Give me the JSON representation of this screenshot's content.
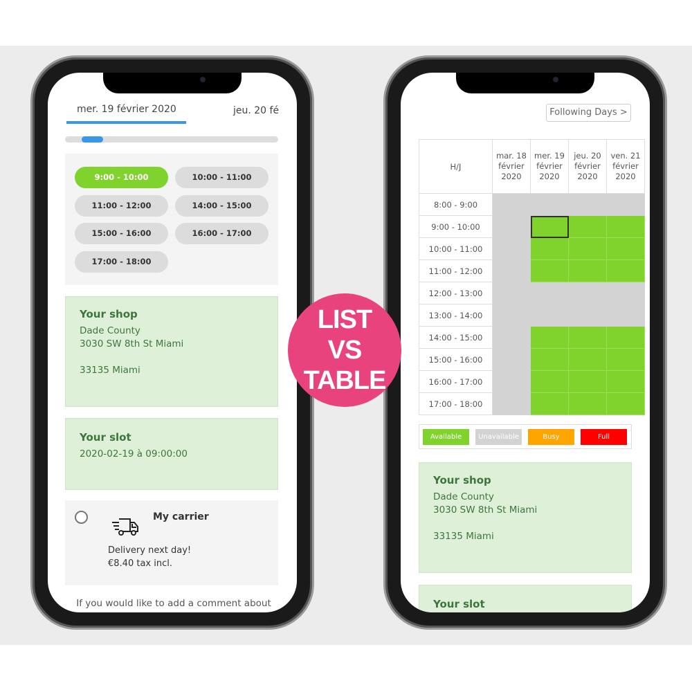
{
  "badge": {
    "line1": "LIST",
    "line2": "VS",
    "line3": "TABLE",
    "color": "#e8437c"
  },
  "list_view": {
    "tabs": [
      {
        "label": "mer. 19 février 2020",
        "active": true
      },
      {
        "label": "jeu. 20 fé",
        "active": false
      }
    ],
    "accent": "#3a97e8",
    "slots": [
      {
        "label": "9:00 - 10:00",
        "selected": true
      },
      {
        "label": "10:00 - 11:00"
      },
      {
        "label": "11:00 - 12:00"
      },
      {
        "label": "14:00 - 15:00"
      },
      {
        "label": "15:00 - 16:00"
      },
      {
        "label": "16:00 - 17:00"
      },
      {
        "label": "17:00 - 18:00"
      }
    ],
    "shop": {
      "title": "Your shop",
      "line1": "Dade County",
      "line2": "3030 SW 8th St Miami",
      "line3": "33135 Miami"
    },
    "slot_box": {
      "title": "Your slot",
      "value": "2020-02-19 à 09:00:00"
    },
    "carrier": {
      "name": "My carrier",
      "icon": "delivery-truck-icon",
      "desc": "Delivery next day!",
      "price": "€8.40 tax incl."
    },
    "comment": "If you would like to add a comment about your order, please write it in the field below."
  },
  "table_view": {
    "following_btn": "Following Days >",
    "corner": "H/J",
    "days": [
      "mar. 18 février 2020",
      "mer. 19 février 2020",
      "jeu. 20 février 2020",
      "ven. 21 février 2020"
    ],
    "hours": [
      "8:00 - 9:00",
      "9:00 - 10:00",
      "10:00 - 11:00",
      "11:00 - 12:00",
      "12:00 - 13:00",
      "13:00 - 14:00",
      "14:00 - 15:00",
      "15:00 - 16:00",
      "16:00 - 17:00",
      "17:00 - 18:00"
    ],
    "status": [
      [
        "u",
        "u",
        "u",
        "u"
      ],
      [
        "u",
        "a",
        "a",
        "a"
      ],
      [
        "u",
        "a",
        "a",
        "a"
      ],
      [
        "u",
        "a",
        "a",
        "a"
      ],
      [
        "u",
        "u",
        "u",
        "u"
      ],
      [
        "u",
        "u",
        "u",
        "u"
      ],
      [
        "u",
        "a",
        "a",
        "a"
      ],
      [
        "u",
        "a",
        "a",
        "a"
      ],
      [
        "u",
        "a",
        "a",
        "a"
      ],
      [
        "u",
        "a",
        "a",
        "a"
      ]
    ],
    "selected": {
      "hour": "9:00 - 10:00",
      "day": "mer. 19 février 2020"
    },
    "legend": [
      {
        "label": "Available",
        "color": "#80d22c"
      },
      {
        "label": "Unavailable",
        "color": "#d3d3d3"
      },
      {
        "label": "Busy",
        "color": "#ffa500"
      },
      {
        "label": "Full",
        "color": "#ff0000"
      }
    ],
    "shop": {
      "title": "Your shop",
      "line1": "Dade County",
      "line2": "3030 SW 8th St Miami",
      "line3": "33135 Miami"
    },
    "slot_box": {
      "title": "Your slot"
    }
  }
}
